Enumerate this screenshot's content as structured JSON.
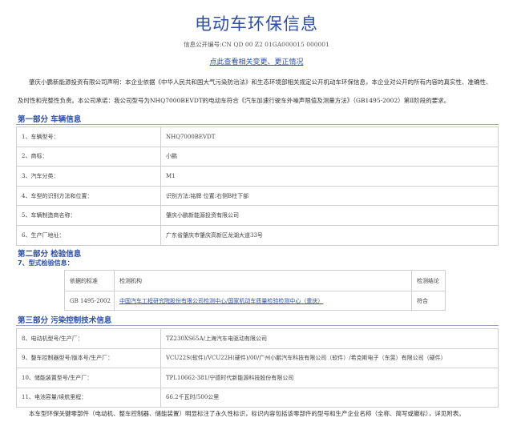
{
  "header": {
    "title": "电动车环保信息",
    "info_no": "信息公开编号:CN QD 00 Z2 01GA000015 000001",
    "change_link": "点此查看相关变更、更正情况",
    "intro": "肇庆小鹏新能源投资有限公司声明：本企业依据《中华人民共和国大气污染防治法》和生态环境部相关规定公开机动车环保信息，本企业对公开的所有内容的真实性、准确性、及时性和完整性负责。本公司承诺：我公司型号为NHQ7000BEVDT的电动车符合《汽车加速行驶车外噪声限值及测量方法》（GB1495-2002）第Ⅱ阶段的要求。"
  },
  "part1": {
    "heading": "第一部分 车辆信息",
    "rows": [
      {
        "label": "1、车辆型号：",
        "value": "NHQ7000BEVDT"
      },
      {
        "label": "2、商标：",
        "value": "小鹏"
      },
      {
        "label": "3、汽车分类：",
        "value": "M1"
      },
      {
        "label": "4、车型的识别方法和位置：",
        "value": "识别方法:铭牌 位置:右侧B柱下部"
      },
      {
        "label": "5、车辆制造商名称：",
        "value": "肇庆小鹏新能源投资有限公司"
      },
      {
        "label": "6、生产厂地址：",
        "value": "广东省肇庆市肇庆高新区龙湖大道33号"
      }
    ]
  },
  "part2": {
    "heading": "第二部分 检验信息",
    "subheading": "7、型式检验信息：",
    "headers": [
      "依据的标准",
      "检测机构",
      "检测结论"
    ],
    "rows": [
      {
        "standard": "GB 1495-2002",
        "org": "中国汽车工程研究院股份有限公司检测中心/国家机动车质量检验检测中心（重庆）",
        "result": "符合"
      }
    ]
  },
  "part3": {
    "heading": "第三部分 污染控制技术信息",
    "rows": [
      {
        "label": "8、电动机型号/生产厂：",
        "value": "TZ230XS65A/上海汽车电驱动有限公司"
      },
      {
        "label": "9、整车控制器型号/版本号/生产厂：",
        "value": "VCU22S(软件)/VCU22H(硬件)/00/广州小鹏汽车科技有限公司（软件）/希克斯电子（东莞）有限公司（硬件）"
      },
      {
        "label": "10、储能装置型号/生产厂：",
        "value": "TPL10662-381/宁德时代新能源科技股份有限公司"
      },
      {
        "label": "11、电池容量/续航里程：",
        "value": "66.2千瓦时/500公里"
      }
    ]
  },
  "footer": {
    "text": "本车型环保关键零部件（电动机、整车控制器、储能装置）明显标注了永久性标识，标识内容包括该零部件的型号和生产企业名称（全称、简写或徽标），详见附表。"
  }
}
